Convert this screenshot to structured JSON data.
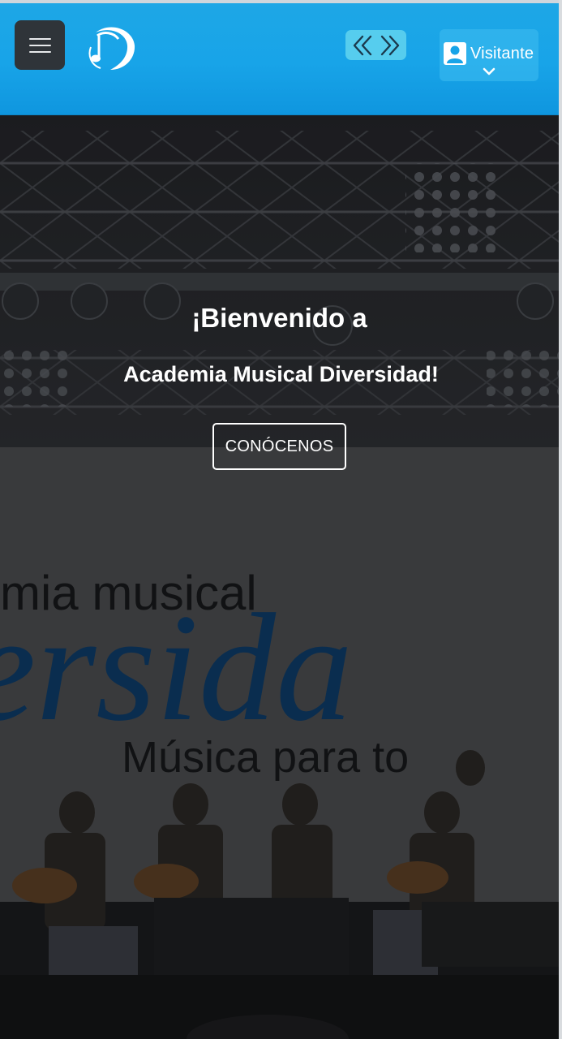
{
  "header": {
    "menu_icon": "hamburger-menu-icon",
    "logo_icon": "music-note-logo-icon",
    "nav_icon": "double-chevron-icon",
    "user": {
      "icon": "user-avatar-icon",
      "label": "Visitante",
      "dropdown_icon": "chevron-down-icon"
    },
    "colors": {
      "bar": "#18a4e8",
      "menu_button": "#2f3439",
      "nav_button": "#56cdee"
    }
  },
  "hero": {
    "title": "¡Bienvenido a",
    "subtitle": "Academia Musical Diversidad!",
    "cta_label": "CONÓCENOS",
    "banner": {
      "line1": "mia musical",
      "line2": "ersida",
      "line3": "Música para to"
    }
  }
}
